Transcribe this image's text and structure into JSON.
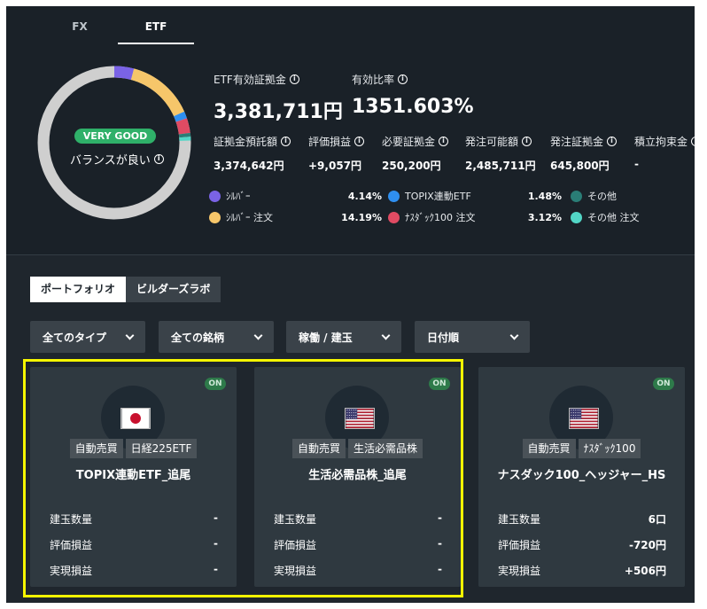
{
  "tabs": [
    "FX",
    "ETF"
  ],
  "donut": {
    "badge": "VERY GOOD",
    "label": "バランスが良い",
    "segments": [
      {
        "name": "シルバー",
        "pct": 4.14,
        "color": "#7a63e6"
      },
      {
        "name": "シルバー 注文",
        "pct": 14.19,
        "color": "#f6c66a"
      },
      {
        "name": "TOPIX連動ETF",
        "pct": 1.48,
        "color": "#2f8ff0"
      },
      {
        "name": "ナスダック100 注文",
        "pct": 3.12,
        "color": "#e04b63"
      },
      {
        "name": "その他",
        "pct": 0,
        "color": "#2a7d76"
      },
      {
        "name": "その他 注文",
        "pct": 0,
        "color": "#52d6c6"
      }
    ],
    "remainder_color": "#cfcfcf"
  },
  "summary": {
    "margin_label": "ETF有効証拠金",
    "margin_value": "3,381,711円",
    "ratio_label": "有効比率",
    "ratio_value": "1351.603%",
    "items": [
      {
        "label": "証拠金預託額",
        "value": "3,374,642円"
      },
      {
        "label": "評価損益",
        "value": "+9,057円"
      },
      {
        "label": "必要証拠金",
        "value": "250,200円"
      },
      {
        "label": "発注可能額",
        "value": "2,485,711円"
      },
      {
        "label": "発注証拠金",
        "value": "645,800円"
      },
      {
        "label": "積立拘束金",
        "value": "-"
      }
    ]
  },
  "legend": [
    {
      "name": "ｼﾙﾊﾞｰ",
      "pct": "4.14%",
      "color": "#7a63e6"
    },
    {
      "name": "TOPIX連動ETF",
      "pct": "1.48%",
      "color": "#2f8ff0"
    },
    {
      "name": "その他",
      "pct": "",
      "color": "#2a7d76"
    },
    {
      "name": "ｼﾙﾊﾞｰ 注文",
      "pct": "14.19%",
      "color": "#f6c66a"
    },
    {
      "name": "ﾅｽﾀﾞｯｸ100 注文",
      "pct": "3.12%",
      "color": "#e04b63"
    },
    {
      "name": "その他 注文",
      "pct": "",
      "color": "#52d6c6"
    }
  ],
  "segment": [
    "ポートフォリオ",
    "ビルダーズラボ"
  ],
  "filters": [
    "全てのタイプ",
    "全ての銘柄",
    "稼働 / 建玉",
    "日付順"
  ],
  "cards": [
    {
      "status": "ON",
      "flag": "jp",
      "tags": [
        "自動売買",
        "日経225ETF"
      ],
      "name": "TOPIX連動ETF_追尾",
      "rows": [
        {
          "k": "建玉数量",
          "v": "-"
        },
        {
          "k": "評価損益",
          "v": "-"
        },
        {
          "k": "実現損益",
          "v": "-"
        }
      ]
    },
    {
      "status": "ON",
      "flag": "us",
      "tags": [
        "自動売買",
        "生活必需品株"
      ],
      "name": "生活必需品株_追尾",
      "rows": [
        {
          "k": "建玉数量",
          "v": "-"
        },
        {
          "k": "評価損益",
          "v": "-"
        },
        {
          "k": "実現損益",
          "v": "-"
        }
      ]
    },
    {
      "status": "ON",
      "flag": "us",
      "tags": [
        "自動売買",
        "ﾅｽﾀﾞｯｸ100"
      ],
      "name": "ナスダック100_ヘッジャー_HS",
      "rows": [
        {
          "k": "建玉数量",
          "v": "6口"
        },
        {
          "k": "評価損益",
          "v": "-720円"
        },
        {
          "k": "実現損益",
          "v": "+506円"
        }
      ]
    }
  ]
}
